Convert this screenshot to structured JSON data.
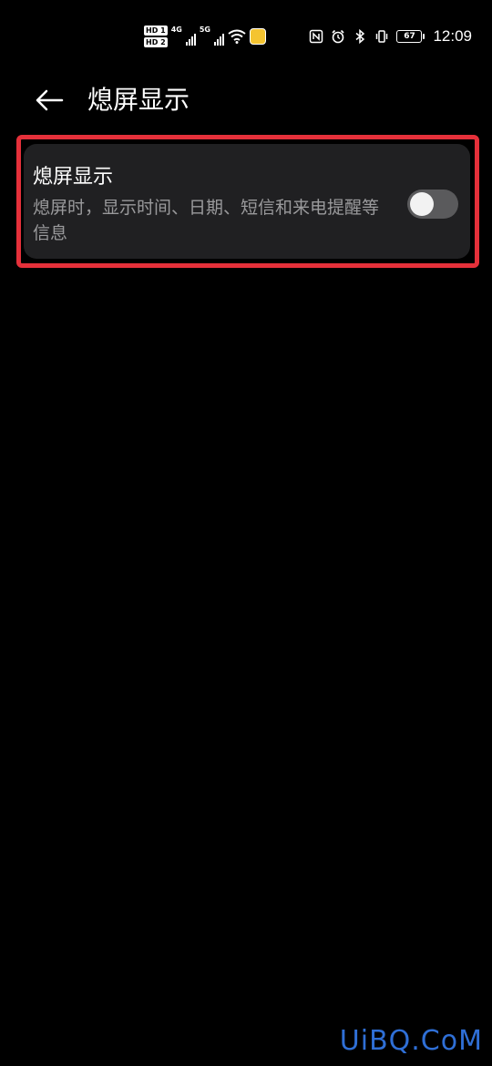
{
  "status_bar": {
    "sim1_badge": "HD 1",
    "sim2_badge": "HD 2",
    "sim1_network": "4G",
    "sim2_network": "5G",
    "icons": [
      "nfc-icon",
      "alarm-icon",
      "bluetooth-icon",
      "vibrate-icon"
    ],
    "battery_level": "67",
    "time": "12:09"
  },
  "header": {
    "title": "熄屏显示"
  },
  "setting": {
    "title": "熄屏显示",
    "description": "熄屏时，显示时间、日期、短信和来电提醒等信息",
    "toggle_state": "off"
  },
  "colors": {
    "background": "#000000",
    "card": "#202022",
    "highlight_border": "#e5303a",
    "toggle_track_off": "#5a5a5c",
    "watermark": "#2f6fd6"
  },
  "watermark": "UiBQ.CoM"
}
